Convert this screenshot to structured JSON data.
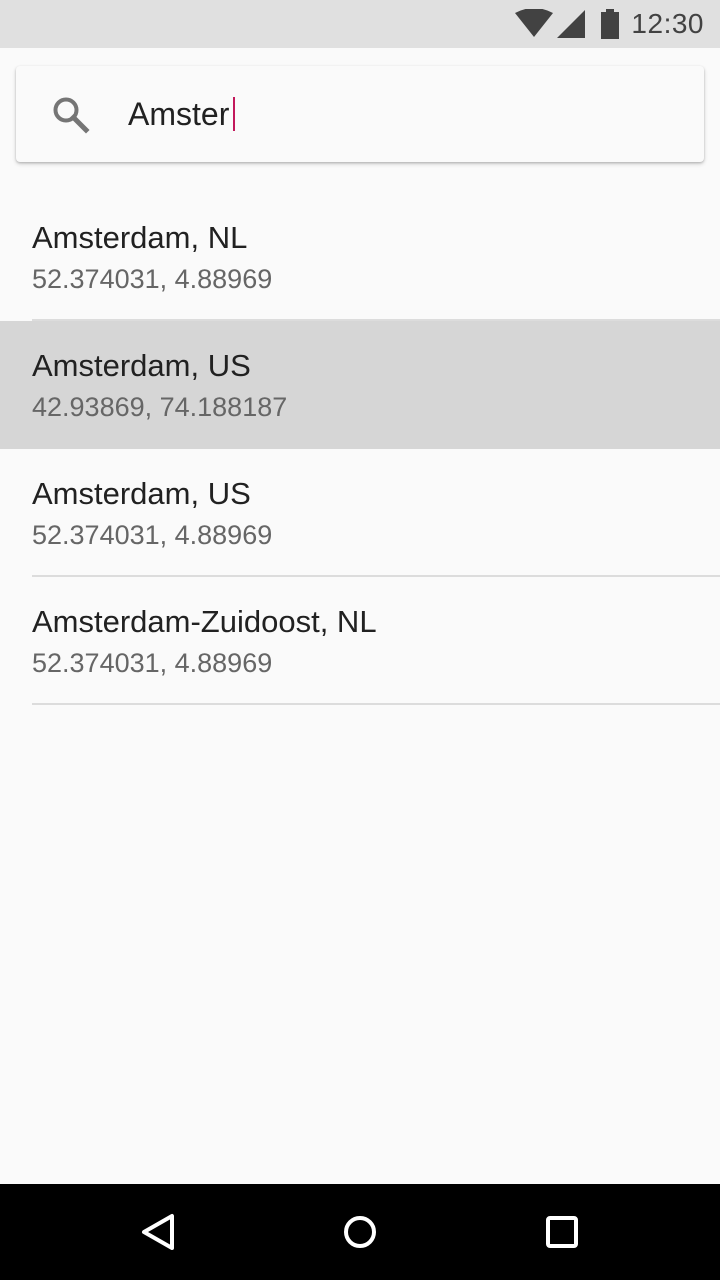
{
  "status_bar": {
    "time": "12:30",
    "icons": [
      "wifi-icon",
      "signal-icon",
      "battery-icon"
    ],
    "background": "#e0e0e0"
  },
  "search": {
    "query": "Amster",
    "icon": "search-icon",
    "cursor_color": "#c2185b"
  },
  "results": [
    {
      "title": "Amsterdam, NL",
      "subtitle": "52.374031, 4.88969",
      "selected": false
    },
    {
      "title": "Amsterdam, US",
      "subtitle": "42.93869, 74.188187",
      "selected": true
    },
    {
      "title": "Amsterdam, US",
      "subtitle": "52.374031, 4.88969",
      "selected": false
    },
    {
      "title": "Amsterdam-Zuidoost, NL",
      "subtitle": "52.374031, 4.88969",
      "selected": false
    }
  ],
  "nav_bar": {
    "buttons": [
      "back-icon",
      "home-icon",
      "recents-icon"
    ],
    "background": "#000000"
  }
}
